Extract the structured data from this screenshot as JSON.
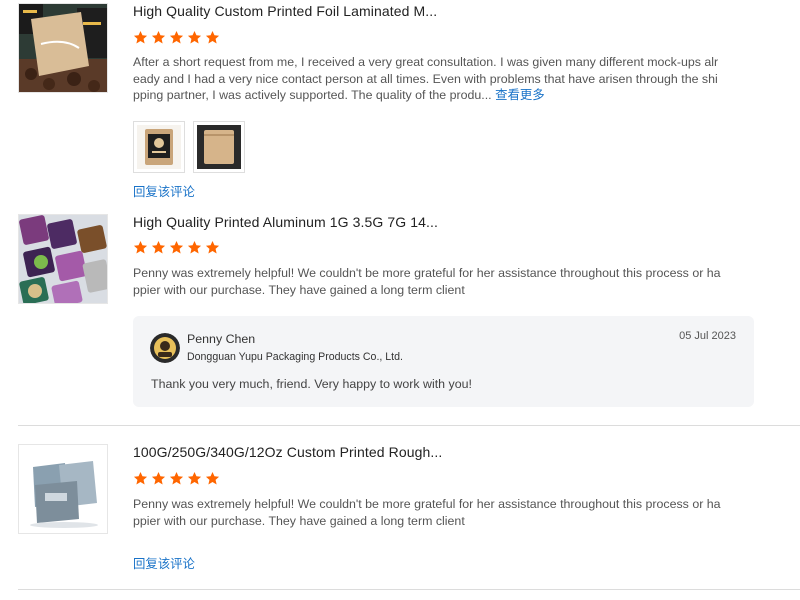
{
  "reviews": [
    {
      "title": "High Quality Custom Printed Foil Laminated M...",
      "rating": 5,
      "text": "After a short request from me, I received a very great consultation. I was given many different mock-ups already and I had a very nice contact person at all times. Even with problems that have arisen through the shipping partner, I was actively supported. The quality of the produ...",
      "more_label": "查看更多",
      "photos": [
        "coffee-bag-black-photo",
        "kraft-pouch-photo"
      ],
      "reply_link": "回复该评论"
    },
    {
      "title": "High Quality Printed Aluminum 1G 3.5G 7G 14...",
      "rating": 5,
      "text": "Penny was extremely helpful! We couldn't be more grateful for her assistance throughout this process or happier with our purchase. They have gained a long term client",
      "seller_reply": {
        "name": "Penny Chen",
        "company": "Dongguan Yupu Packaging Products Co., Ltd.",
        "date": "05 Jul 2023",
        "text": "Thank you very much, friend. Very happy to work with you!"
      }
    },
    {
      "title": "100G/250G/340G/12Oz Custom Printed Rough...",
      "rating": 5,
      "text": "Penny was extremely helpful! We couldn't be more grateful for her assistance throughout this process or happier with our purchase. They have gained a long term client",
      "reply_link": "回复该评论"
    }
  ],
  "colors": {
    "star": "#ff6600",
    "link": "#1a73c8",
    "reply_bg": "#f4f5f7"
  }
}
